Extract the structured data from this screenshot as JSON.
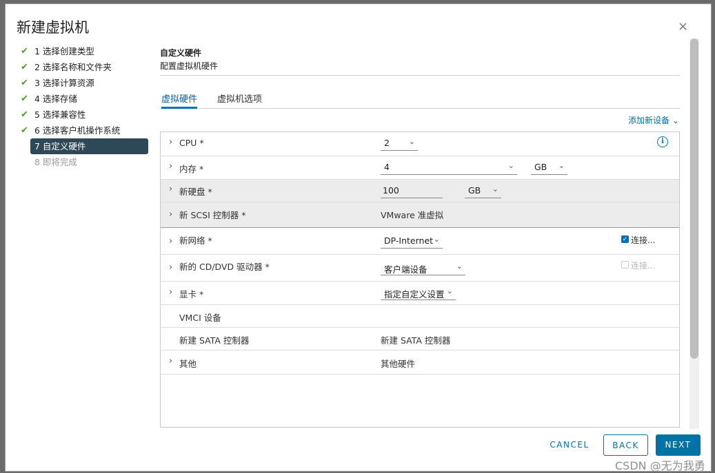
{
  "dialog": {
    "title": "新建虚拟机",
    "close_glyph": "×"
  },
  "steps": [
    {
      "label": "1 选择创建类型",
      "state": "done"
    },
    {
      "label": "2 选择名称和文件夹",
      "state": "done"
    },
    {
      "label": "3 选择计算资源",
      "state": "done"
    },
    {
      "label": "4 选择存储",
      "state": "done"
    },
    {
      "label": "5 选择兼容性",
      "state": "done"
    },
    {
      "label": "6 选择客户机操作系统",
      "state": "done"
    },
    {
      "label": "7 自定义硬件",
      "state": "active"
    },
    {
      "label": "8 即将完成",
      "state": "future"
    }
  ],
  "check_glyph": "✔",
  "section": {
    "title": "自定义硬件",
    "subtitle": "配置虚拟机硬件"
  },
  "tabs": [
    {
      "label": "虚拟硬件",
      "active": true
    },
    {
      "label": "虚拟机选项",
      "active": false
    }
  ],
  "add_device": "添加新设备 ⌄",
  "hardware": {
    "cpu": {
      "label": "CPU *",
      "value": "2"
    },
    "memory": {
      "label": "内存 *",
      "value": "4",
      "unit": "GB"
    },
    "disk": {
      "label": "新硬盘 *",
      "value": "100",
      "unit": "GB"
    },
    "scsi": {
      "label": "新 SCSI 控制器 *",
      "value": "VMware 准虚拟"
    },
    "network": {
      "label": "新网络 *",
      "value": "DP-Internet",
      "connect_label": "连接...",
      "connected": true
    },
    "cdrom": {
      "label": "新的 CD/DVD 驱动器 *",
      "value": "客户端设备",
      "connect_label": "连接...",
      "connected": false
    },
    "video": {
      "label": "显卡 *",
      "value": "指定自定义设置"
    },
    "vmci": {
      "label": "VMCI 设备"
    },
    "sata": {
      "label": "新建 SATA 控制器",
      "value": "新建 SATA 控制器"
    },
    "other": {
      "label": "其他",
      "value": "其他硬件"
    }
  },
  "icons": {
    "arrow": "›",
    "dropdown": "⌄",
    "info": "i",
    "check": "✓"
  },
  "footer": {
    "cancel": "CANCEL",
    "back": "BACK",
    "next": "NEXT"
  },
  "watermark": "CSDN @无为我勇",
  "colors": {
    "accent": "#0072a3",
    "active_step_bg": "#2f4858",
    "check_green": "#48a02e"
  }
}
